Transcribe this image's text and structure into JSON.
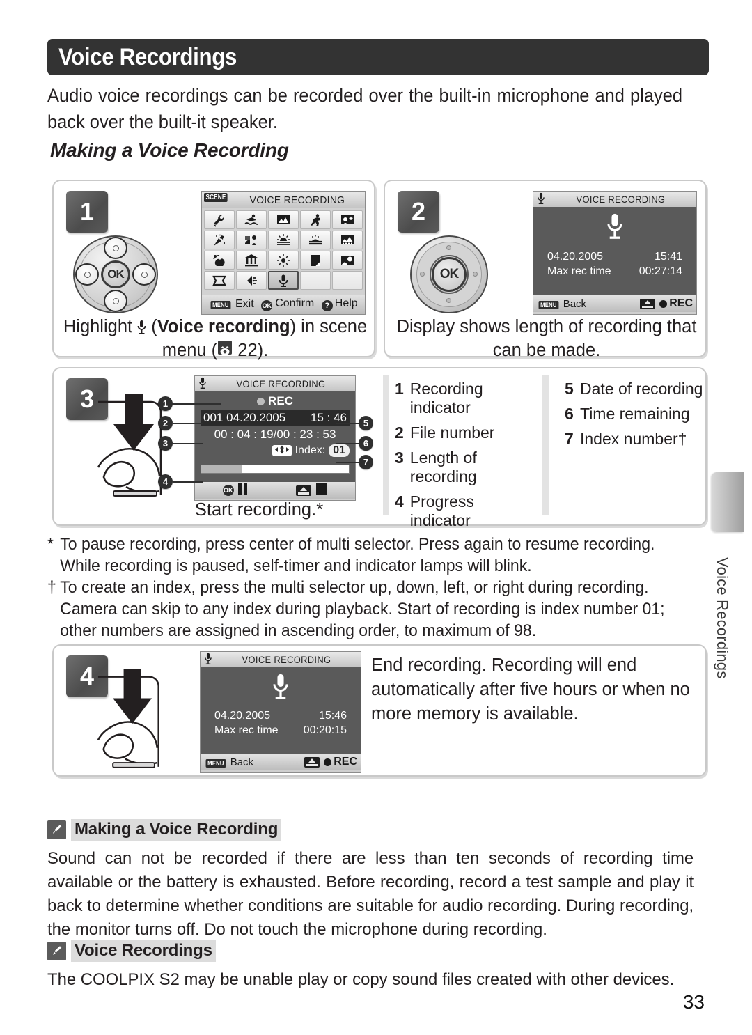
{
  "header": {
    "title": "Voice Recordings"
  },
  "intro": "Audio voice recordings can be recorded over the built-in microphone and played back over the built-it speaker.",
  "subhead": "Making a Voice Recording",
  "steps": [
    {
      "number": "1",
      "caption_parts": {
        "a": "Highlight ",
        "b": " (",
        "bold": "Voice recording",
        "c": ") in scene menu (",
        "d": " 22)."
      },
      "lcd": {
        "tag": "SCENE",
        "title": "VOICE RECORDING",
        "footer": {
          "exit": "Exit",
          "exit_chip": "MENU",
          "confirm": "Confirm",
          "confirm_chip": "OK",
          "help": "Help",
          "help_chip": "?"
        },
        "scene_icons": [
          "wrench-icon",
          "swimmer-icon",
          "landscape-icon",
          "runner-icon",
          "portrait-star-icon",
          "party-icon",
          "night-portrait-icon",
          "sunset-icon",
          "dusk-dawn-icon",
          "night-landscape-icon",
          "close-up-icon",
          "museum-icon",
          "fireworks-icon",
          "copy-icon",
          "backlight-icon",
          "panorama-icon",
          "sports-icon",
          "voice-recording-icon",
          "empty",
          "empty"
        ],
        "selected_index": 17
      }
    },
    {
      "number": "2",
      "caption": "Display shows length of recording that can be made.",
      "lcd": {
        "title": "VOICE RECORDING",
        "date": "04.20.2005",
        "time": "15:41",
        "max_label": "Max rec time",
        "max_value": "00:27:14",
        "footer": {
          "back_chip": "MENU",
          "back": "Back",
          "rec": "REC"
        }
      }
    },
    {
      "number": "3",
      "caption": "Start recording.*",
      "lcd": {
        "title": "VOICE RECORDING",
        "rec_label": "REC",
        "file_number": "001",
        "date": "04.20.2005",
        "time": "15 : 46",
        "elapsed_total": "00 : 04 : 19/00 : 23 : 53",
        "index_label": "Index:",
        "index_value": "01"
      }
    },
    {
      "number": "4",
      "caption": "End recording.  Recording will end automatically after five hours or when no more memory is available.",
      "lcd": {
        "title": "VOICE RECORDING",
        "date": "04.20.2005",
        "time": "15:46",
        "max_label": "Max rec time",
        "max_value": "00:20:15",
        "footer": {
          "back_chip": "MENU",
          "back": "Back",
          "rec": "REC"
        }
      }
    }
  ],
  "legend": {
    "left": [
      {
        "n": "1",
        "text": "Recording indicator"
      },
      {
        "n": "2",
        "text": "File number"
      },
      {
        "n": "3",
        "text": "Length of recording"
      },
      {
        "n": "4",
        "text": "Progress indicator"
      }
    ],
    "right": [
      {
        "n": "5",
        "text": "Date of recording"
      },
      {
        "n": "6",
        "text": "Time remaining"
      },
      {
        "n": "7",
        "text": "Index number†"
      }
    ]
  },
  "footnotes": [
    {
      "mark": "*",
      "text": "To pause recording, press center of multi selector.  Press again to resume recording.  While recording is paused, self-timer and indicator lamps will blink."
    },
    {
      "mark": "†",
      "text": "To create an index, press the multi selector up, down, left, or right during recording.  Camera can skip to any index during playback.  Start of recording is index number 01; other numbers are assigned in ascending order, to maximum of 98."
    }
  ],
  "notes": [
    {
      "title": "Making a Voice Recording",
      "body": "Sound can not be recorded if there are less than ten seconds of recording time available or the battery is exhausted.  Before recording, record a test sample and play it back to determine whether conditions are suitable for audio recording.  During recording, the monitor turns off.  Do not touch the microphone during recording."
    },
    {
      "title": "Voice Recordings",
      "body": "The COOLPIX S2 may be unable play or copy sound files created with other devices."
    }
  ],
  "side_tab_label": "Voice Recordings",
  "page_number": "33",
  "colors": {
    "header_bg": "#333333",
    "note_highlight": "#dcdcdc",
    "lcd_body": "#5a5a5a"
  }
}
